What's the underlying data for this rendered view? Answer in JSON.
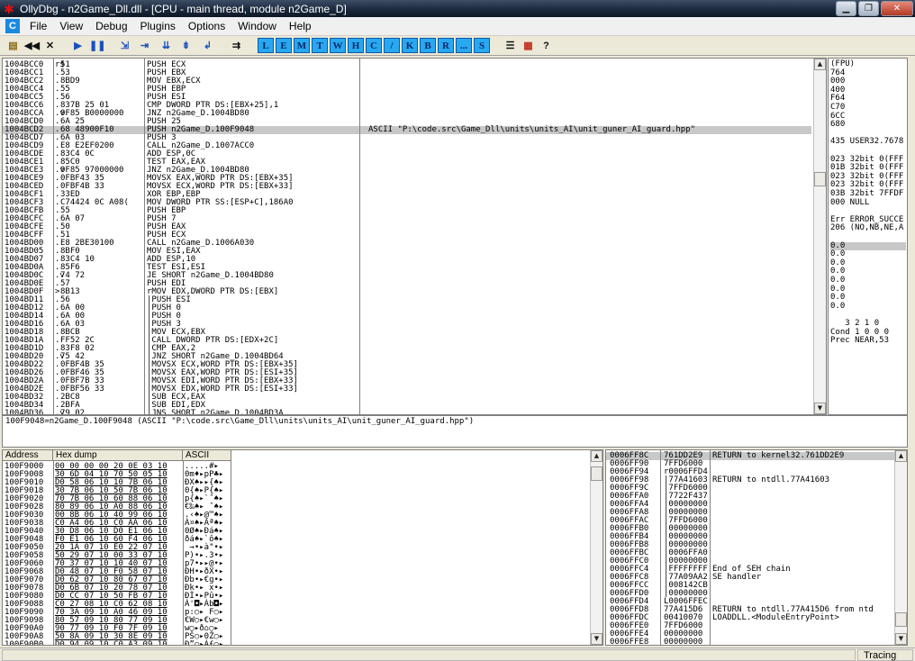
{
  "window": {
    "title": "OllyDbg - n2Game_Dll.dll - [CPU - main thread, module n2Game_D]"
  },
  "menu": [
    "File",
    "View",
    "Debug",
    "Plugins",
    "Options",
    "Window",
    "Help"
  ],
  "toolbar": {
    "letters": [
      "L",
      "E",
      "M",
      "T",
      "W",
      "H",
      "C",
      "/",
      "K",
      "B",
      "R",
      "...",
      "S"
    ]
  },
  "cpu": {
    "rows": [
      {
        "addr": "1004BCC0",
        "mark": "r$",
        "hex": "51",
        "dis": "PUSH ECX",
        "cmt": ""
      },
      {
        "addr": "1004BCC1",
        "mark": ".",
        "hex": "53",
        "dis": "PUSH EBX",
        "cmt": ""
      },
      {
        "addr": "1004BCC2",
        "mark": ".",
        "hex": "8BD9",
        "dis": "MOV EBX,ECX",
        "cmt": ""
      },
      {
        "addr": "1004BCC4",
        "mark": ".",
        "hex": "55",
        "dis": "PUSH EBP",
        "cmt": ""
      },
      {
        "addr": "1004BCC5",
        "mark": ".",
        "hex": "56",
        "dis": "PUSH ESI",
        "cmt": ""
      },
      {
        "addr": "1004BCC6",
        "mark": ".",
        "hex": "837B 25 01",
        "dis": "CMP DWORD PTR DS:[EBX+25],1",
        "cmt": ""
      },
      {
        "addr": "1004BCCA",
        "mark": ".v",
        "hex": "0F85 B0000000",
        "dis": "JNZ n2Game_D.1004BD80",
        "cmt": ""
      },
      {
        "addr": "1004BCD0",
        "mark": ".",
        "hex": "6A 25",
        "dis": "PUSH 25",
        "cmt": ""
      },
      {
        "addr": "1004BCD2",
        "mark": ".",
        "hex": "68 48900F10",
        "dis": "PUSH n2Game_D.100F9048",
        "cmt": "ASCII \"P:\\code.src\\Game_Dll\\units\\units_AI\\unit_guner_AI_guard.hpp\""
      },
      {
        "addr": "1004BCD7",
        "mark": ".",
        "hex": "6A 03",
        "dis": "PUSH 3",
        "cmt": ""
      },
      {
        "addr": "1004BCD9",
        "mark": ".",
        "hex": "E8 E2EF0200",
        "dis": "CALL n2Game_D.1007ACC0",
        "cmt": ""
      },
      {
        "addr": "1004BCDE",
        "mark": ".",
        "hex": "83C4 0C",
        "dis": "ADD ESP,0C",
        "cmt": ""
      },
      {
        "addr": "1004BCE1",
        "mark": ".",
        "hex": "85C0",
        "dis": "TEST EAX,EAX",
        "cmt": ""
      },
      {
        "addr": "1004BCE3",
        "mark": ".v",
        "hex": "0F85 97000000",
        "dis": "JNZ n2Game_D.1004BD80",
        "cmt": ""
      },
      {
        "addr": "1004BCE9",
        "mark": ".",
        "hex": "0FBF43 35",
        "dis": "MOVSX EAX,WORD PTR DS:[EBX+35]",
        "cmt": ""
      },
      {
        "addr": "1004BCED",
        "mark": ".",
        "hex": "0FBF4B 33",
        "dis": "MOVSX ECX,WORD PTR DS:[EBX+33]",
        "cmt": ""
      },
      {
        "addr": "1004BCF1",
        "mark": ".",
        "hex": "33ED",
        "dis": "XOR EBP,EBP",
        "cmt": ""
      },
      {
        "addr": "1004BCF3",
        "mark": ".",
        "hex": "C74424 0C A08(",
        "dis": "MOV DWORD PTR SS:[ESP+C],186A0",
        "cmt": ""
      },
      {
        "addr": "1004BCFB",
        "mark": ".",
        "hex": "55",
        "dis": "PUSH EBP",
        "cmt": ""
      },
      {
        "addr": "1004BCFC",
        "mark": ".",
        "hex": "6A 07",
        "dis": "PUSH 7",
        "cmt": ""
      },
      {
        "addr": "1004BCFE",
        "mark": ".",
        "hex": "50",
        "dis": "PUSH EAX",
        "cmt": ""
      },
      {
        "addr": "1004BCFF",
        "mark": ".",
        "hex": "51",
        "dis": "PUSH ECX",
        "cmt": ""
      },
      {
        "addr": "1004BD00",
        "mark": ".",
        "hex": "E8 2BE30100",
        "dis": "CALL n2Game_D.1006A030",
        "cmt": ""
      },
      {
        "addr": "1004BD05",
        "mark": ".",
        "hex": "8BF0",
        "dis": "MOV ESI,EAX",
        "cmt": ""
      },
      {
        "addr": "1004BD07",
        "mark": ".",
        "hex": "83C4 10",
        "dis": "ADD ESP,10",
        "cmt": ""
      },
      {
        "addr": "1004BD0A",
        "mark": ".",
        "hex": "85F6",
        "dis": "TEST ESI,ESI",
        "cmt": ""
      },
      {
        "addr": "1004BD0C",
        "mark": ".v",
        "hex": "74 72",
        "dis": "JE SHORT n2Game_D.1004BD80",
        "cmt": ""
      },
      {
        "addr": "1004BD0E",
        "mark": ".",
        "hex": "57",
        "dis": "PUSH EDI",
        "cmt": ""
      },
      {
        "addr": "1004BD0F",
        "mark": ">",
        "hex": "8B13",
        "dis": "rMOV EDX,DWORD PTR DS:[EBX]",
        "cmt": ""
      },
      {
        "addr": "1004BD11",
        "mark": ".",
        "hex": "56",
        "dis": "|PUSH ESI",
        "cmt": ""
      },
      {
        "addr": "1004BD12",
        "mark": ".",
        "hex": "6A 00",
        "dis": "|PUSH 0",
        "cmt": ""
      },
      {
        "addr": "1004BD14",
        "mark": ".",
        "hex": "6A 00",
        "dis": "|PUSH 0",
        "cmt": ""
      },
      {
        "addr": "1004BD16",
        "mark": ".",
        "hex": "6A 03",
        "dis": "|PUSH 3",
        "cmt": ""
      },
      {
        "addr": "1004BD18",
        "mark": ".",
        "hex": "8BCB",
        "dis": "|MOV ECX,EBX",
        "cmt": ""
      },
      {
        "addr": "1004BD1A",
        "mark": ".",
        "hex": "FF52 2C",
        "dis": "|CALL DWORD PTR DS:[EDX+2C]",
        "cmt": ""
      },
      {
        "addr": "1004BD1D",
        "mark": ".",
        "hex": "83F8 02",
        "dis": "|CMP EAX,2",
        "cmt": ""
      },
      {
        "addr": "1004BD20",
        "mark": ".v",
        "hex": "75 42",
        "dis": "|JNZ SHORT n2Game_D.1004BD64",
        "cmt": ""
      },
      {
        "addr": "1004BD22",
        "mark": ".",
        "hex": "0FBF4B 35",
        "dis": "|MOVSX ECX,WORD PTR DS:[EBX+35]",
        "cmt": ""
      },
      {
        "addr": "1004BD26",
        "mark": ".",
        "hex": "0FBF46 35",
        "dis": "|MOVSX EAX,WORD PTR DS:[ESI+35]",
        "cmt": ""
      },
      {
        "addr": "1004BD2A",
        "mark": ".",
        "hex": "0FBF7B 33",
        "dis": "|MOVSX EDI,WORD PTR DS:[EBX+33]",
        "cmt": ""
      },
      {
        "addr": "1004BD2E",
        "mark": ".",
        "hex": "0FBF56 33",
        "dis": "|MOVSX EDX,WORD PTR DS:[ESI+33]",
        "cmt": ""
      },
      {
        "addr": "1004BD32",
        "mark": ".",
        "hex": "2BC8",
        "dis": "|SUB ECX,EAX",
        "cmt": ""
      },
      {
        "addr": "1004BD34",
        "mark": ".",
        "hex": "2BFA",
        "dis": "|SUB EDI,EDX",
        "cmt": ""
      },
      {
        "addr": "1004BD36",
        "mark": ".v",
        "hex": "79 02",
        "dis": "|JNS SHORT n2Game_D.1004BD3A",
        "cmt": ""
      }
    ],
    "selected_index": 8
  },
  "registers": [
    "(FPU)",
    "764",
    "000",
    "400",
    "F64",
    "C70",
    "6CC",
    "680",
    "",
    "435 USER32.7678",
    "",
    "023 32bit 0(FFF",
    "01B 32bit 0(FFF",
    "023 32bit 0(FFF",
    "023 32bit 0(FFF",
    "03B 32bit 7FFDF",
    "000 NULL",
    "",
    "Err ERROR_SUCCE",
    "206 (NO,NB,NE,A",
    "",
    "0.0",
    "0.0",
    "0.0",
    "0.0",
    "0.0",
    "0.0",
    "0.0",
    "0.0",
    "",
    "   3 2 1 0",
    "Cond 1 0 0 0",
    "Prec NEAR,53"
  ],
  "info": {
    "text": "100F9048=n2Game_D.100F9048 (ASCII \"P:\\code.src\\Game_Dll\\units\\units_AI\\unit_guner_AI_guard.hpp\")"
  },
  "dump": {
    "headers": [
      "Address",
      "Hex dump",
      "ASCII"
    ],
    "rows": [
      {
        "addr": "100F9000",
        "hex": "00 00 00 00 20 0E 03 10",
        "ascii": ".....#▸"
      },
      {
        "addr": "100F9008",
        "hex": "30 6D 04 10 70 50 05 10",
        "ascii": "0m♦▸pP♣▸"
      },
      {
        "addr": "100F9010",
        "hex": "D0 58 06 10 10 7B 06 10",
        "ascii": "ÐX♠▸▸{♠▸"
      },
      {
        "addr": "100F9018",
        "hex": "30 7B 06 10 50 7B 06 10",
        "ascii": "0{♠▸P{♠▸"
      },
      {
        "addr": "100F9020",
        "hex": "70 7B 06 10 60 88 06 10",
        "ascii": "p{♠▸`ˆ♠▸"
      },
      {
        "addr": "100F9028",
        "hex": "80 89 06 10 A0 88 06 10",
        "ascii": "€‰♠▸ ˆ♠▸"
      },
      {
        "addr": "100F9030",
        "hex": "00 8B 06 10 40 99 06 10",
        "ascii": ".‹♠▸@™♠▸"
      },
      {
        "addr": "100F9038",
        "hex": "C0 A4 06 10 C0 AA 06 10",
        "ascii": "À¤♠▸Àª♠▸"
      },
      {
        "addr": "100F9040",
        "hex": "30 D8 06 10 D0 E1 06 10",
        "ascii": "0Ø♠▸Ðá♠▸"
      },
      {
        "addr": "100F9048",
        "hex": "F0 E1 06 10 60 F4 06 10",
        "ascii": "ðá♠▸`ô♠▸"
      },
      {
        "addr": "100F9050",
        "hex": "20 1A 07 10 E0 22 07 10",
        "ascii": " →•▸à\"•▸"
      },
      {
        "addr": "100F9058",
        "hex": "50 29 07 10 00 33 07 10",
        "ascii": "P)•▸.3•▸"
      },
      {
        "addr": "100F9060",
        "hex": "70 37 07 10 10 40 07 10",
        "ascii": "p7•▸▸@•▸"
      },
      {
        "addr": "100F9068",
        "hex": "D0 48 07 10 F0 58 07 10",
        "ascii": "ÐH•▸ðX•▸"
      },
      {
        "addr": "100F9070",
        "hex": "D0 62 07 10 80 67 07 10",
        "ascii": "Ðb•▸€g•▸"
      },
      {
        "addr": "100F9078",
        "hex": "D0 6B 07 10 20 78 07 10",
        "ascii": "Ðk•▸ x•▸"
      },
      {
        "addr": "100F9080",
        "hex": "D0 CC 07 10 50 FB 07 10",
        "ascii": "ÐÌ•▸Pû•▸"
      },
      {
        "addr": "100F9088",
        "hex": "C0 27 08 10 C0 62 08 10",
        "ascii": "À'◘▸Àb◘▸"
      },
      {
        "addr": "100F9090",
        "hex": "70 3A 09 10 A0 46 09 10",
        "ascii": "p:○▸ F○▸"
      },
      {
        "addr": "100F9098",
        "hex": "80 57 09 10 80 77 09 10",
        "ascii": "€W○▸€w○▸"
      },
      {
        "addr": "100F90A0",
        "hex": "90 77 09 10 F0 7F 09 10",
        "ascii": "w○▸ð⌂○▸"
      },
      {
        "addr": "100F90A8",
        "hex": "50 8A 09 10 30 8E 09 10",
        "ascii": "PŠ○▸0Ž○▸"
      },
      {
        "addr": "100F90B0",
        "hex": "D0 94 09 10 C0 A3 09 10",
        "ascii": "Ð”○▸À£○▸"
      }
    ]
  },
  "stack": {
    "rows": [
      {
        "addr": "0006FF8C",
        "val": "761DD2E9",
        "cmt": "RETURN to kernel32.761DD2E9"
      },
      {
        "addr": "0006FF90",
        "val": "7FFD6000",
        "cmt": ""
      },
      {
        "addr": "0006FF94",
        "val": "r0006FFD4",
        "cmt": ""
      },
      {
        "addr": "0006FF98",
        "val": "|77A41603",
        "cmt": "RETURN to ntdll.77A41603"
      },
      {
        "addr": "0006FF9C",
        "val": "|7FFD6000",
        "cmt": ""
      },
      {
        "addr": "0006FFA0",
        "val": "|7722F437",
        "cmt": ""
      },
      {
        "addr": "0006FFA4",
        "val": "|00000000",
        "cmt": ""
      },
      {
        "addr": "0006FFA8",
        "val": "|00000000",
        "cmt": ""
      },
      {
        "addr": "0006FFAC",
        "val": "|7FFD6000",
        "cmt": ""
      },
      {
        "addr": "0006FFB0",
        "val": "|00000000",
        "cmt": ""
      },
      {
        "addr": "0006FFB4",
        "val": "|00000000",
        "cmt": ""
      },
      {
        "addr": "0006FFB8",
        "val": "|00000000",
        "cmt": ""
      },
      {
        "addr": "0006FFBC",
        "val": "|0006FFA0",
        "cmt": ""
      },
      {
        "addr": "0006FFC0",
        "val": "|00000000",
        "cmt": ""
      },
      {
        "addr": "0006FFC4",
        "val": "|FFFFFFFF",
        "cmt": "End of SEH chain"
      },
      {
        "addr": "0006FFC8",
        "val": "|77A09AA2",
        "cmt": "SE handler"
      },
      {
        "addr": "0006FFCC",
        "val": "|008142CB",
        "cmt": ""
      },
      {
        "addr": "0006FFD0",
        "val": "|00000000",
        "cmt": ""
      },
      {
        "addr": "0006FFD4",
        "val": "L0006FFEC",
        "cmt": ""
      },
      {
        "addr": "0006FFD8",
        "val": "77A415D6",
        "cmt": "RETURN to ntdll.77A415D6 from ntd"
      },
      {
        "addr": "0006FFDC",
        "val": "00410070",
        "cmt": "LOADDLL.<ModuleEntryPoint>"
      },
      {
        "addr": "0006FFE0",
        "val": "7FFD6000",
        "cmt": ""
      },
      {
        "addr": "0006FFE4",
        "val": "00000000",
        "cmt": ""
      },
      {
        "addr": "0006FFE8",
        "val": "00000000",
        "cmt": ""
      }
    ]
  },
  "status": {
    "right": "Tracing"
  }
}
